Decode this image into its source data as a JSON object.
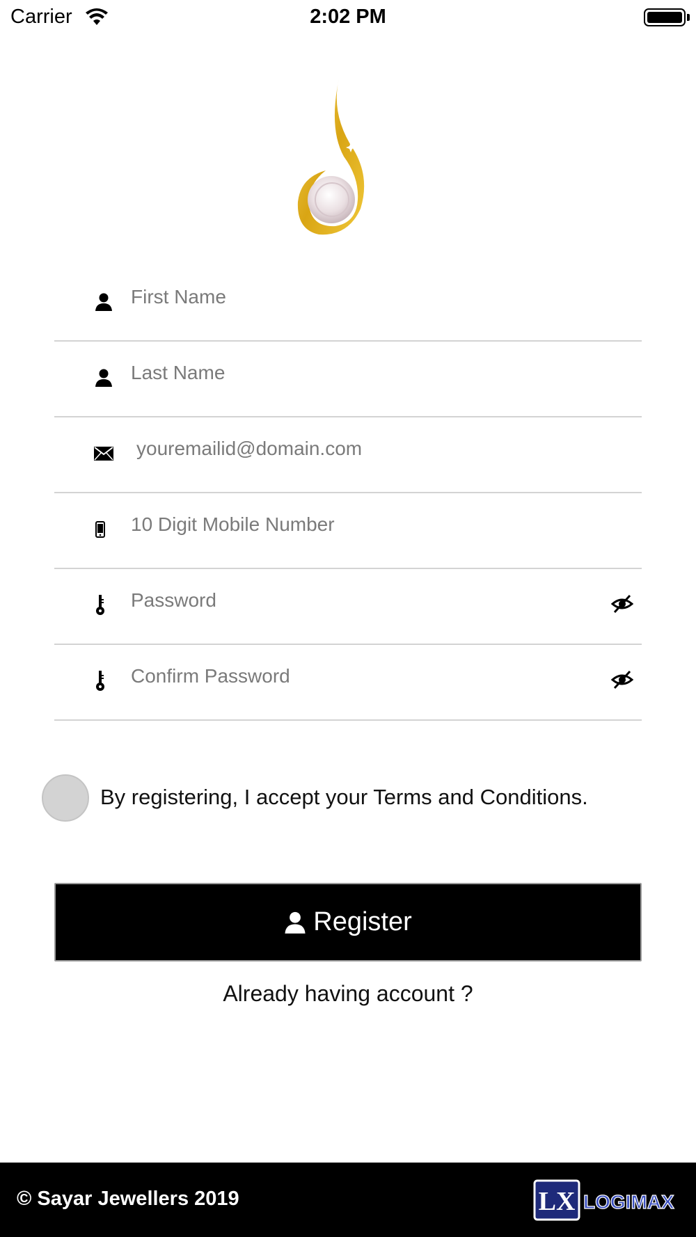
{
  "status_bar": {
    "carrier": "Carrier",
    "time": "2:02 PM"
  },
  "form": {
    "first_name": {
      "placeholder": "First Name",
      "icon": "person-icon"
    },
    "last_name": {
      "placeholder": "Last Name",
      "icon": "person-icon"
    },
    "email": {
      "placeholder": "youremailid@domain.com",
      "icon": "envelope-icon"
    },
    "mobile": {
      "placeholder": "10 Digit Mobile Number",
      "icon": "phone-icon"
    },
    "password": {
      "placeholder": "Password",
      "icon": "key-icon",
      "toggle_icon": "eye-slash-icon"
    },
    "confirm_password": {
      "placeholder": "Confirm Password",
      "icon": "key-icon",
      "toggle_icon": "eye-slash-icon"
    }
  },
  "terms": {
    "checked": false,
    "text": "By registering, I accept your Terms and Conditions."
  },
  "register_button": {
    "label": "Register",
    "icon": "person-icon"
  },
  "login_link": "Already having account ?",
  "footer": {
    "copyright": "© Sayar Jewellers 2019",
    "brand": "LOGIMAX"
  },
  "colors": {
    "gold": "#e2b21e",
    "button_bg": "#000000",
    "footer_bg": "#000000",
    "divider": "#d3d3d3",
    "checkbox": "#d3d3d3"
  }
}
